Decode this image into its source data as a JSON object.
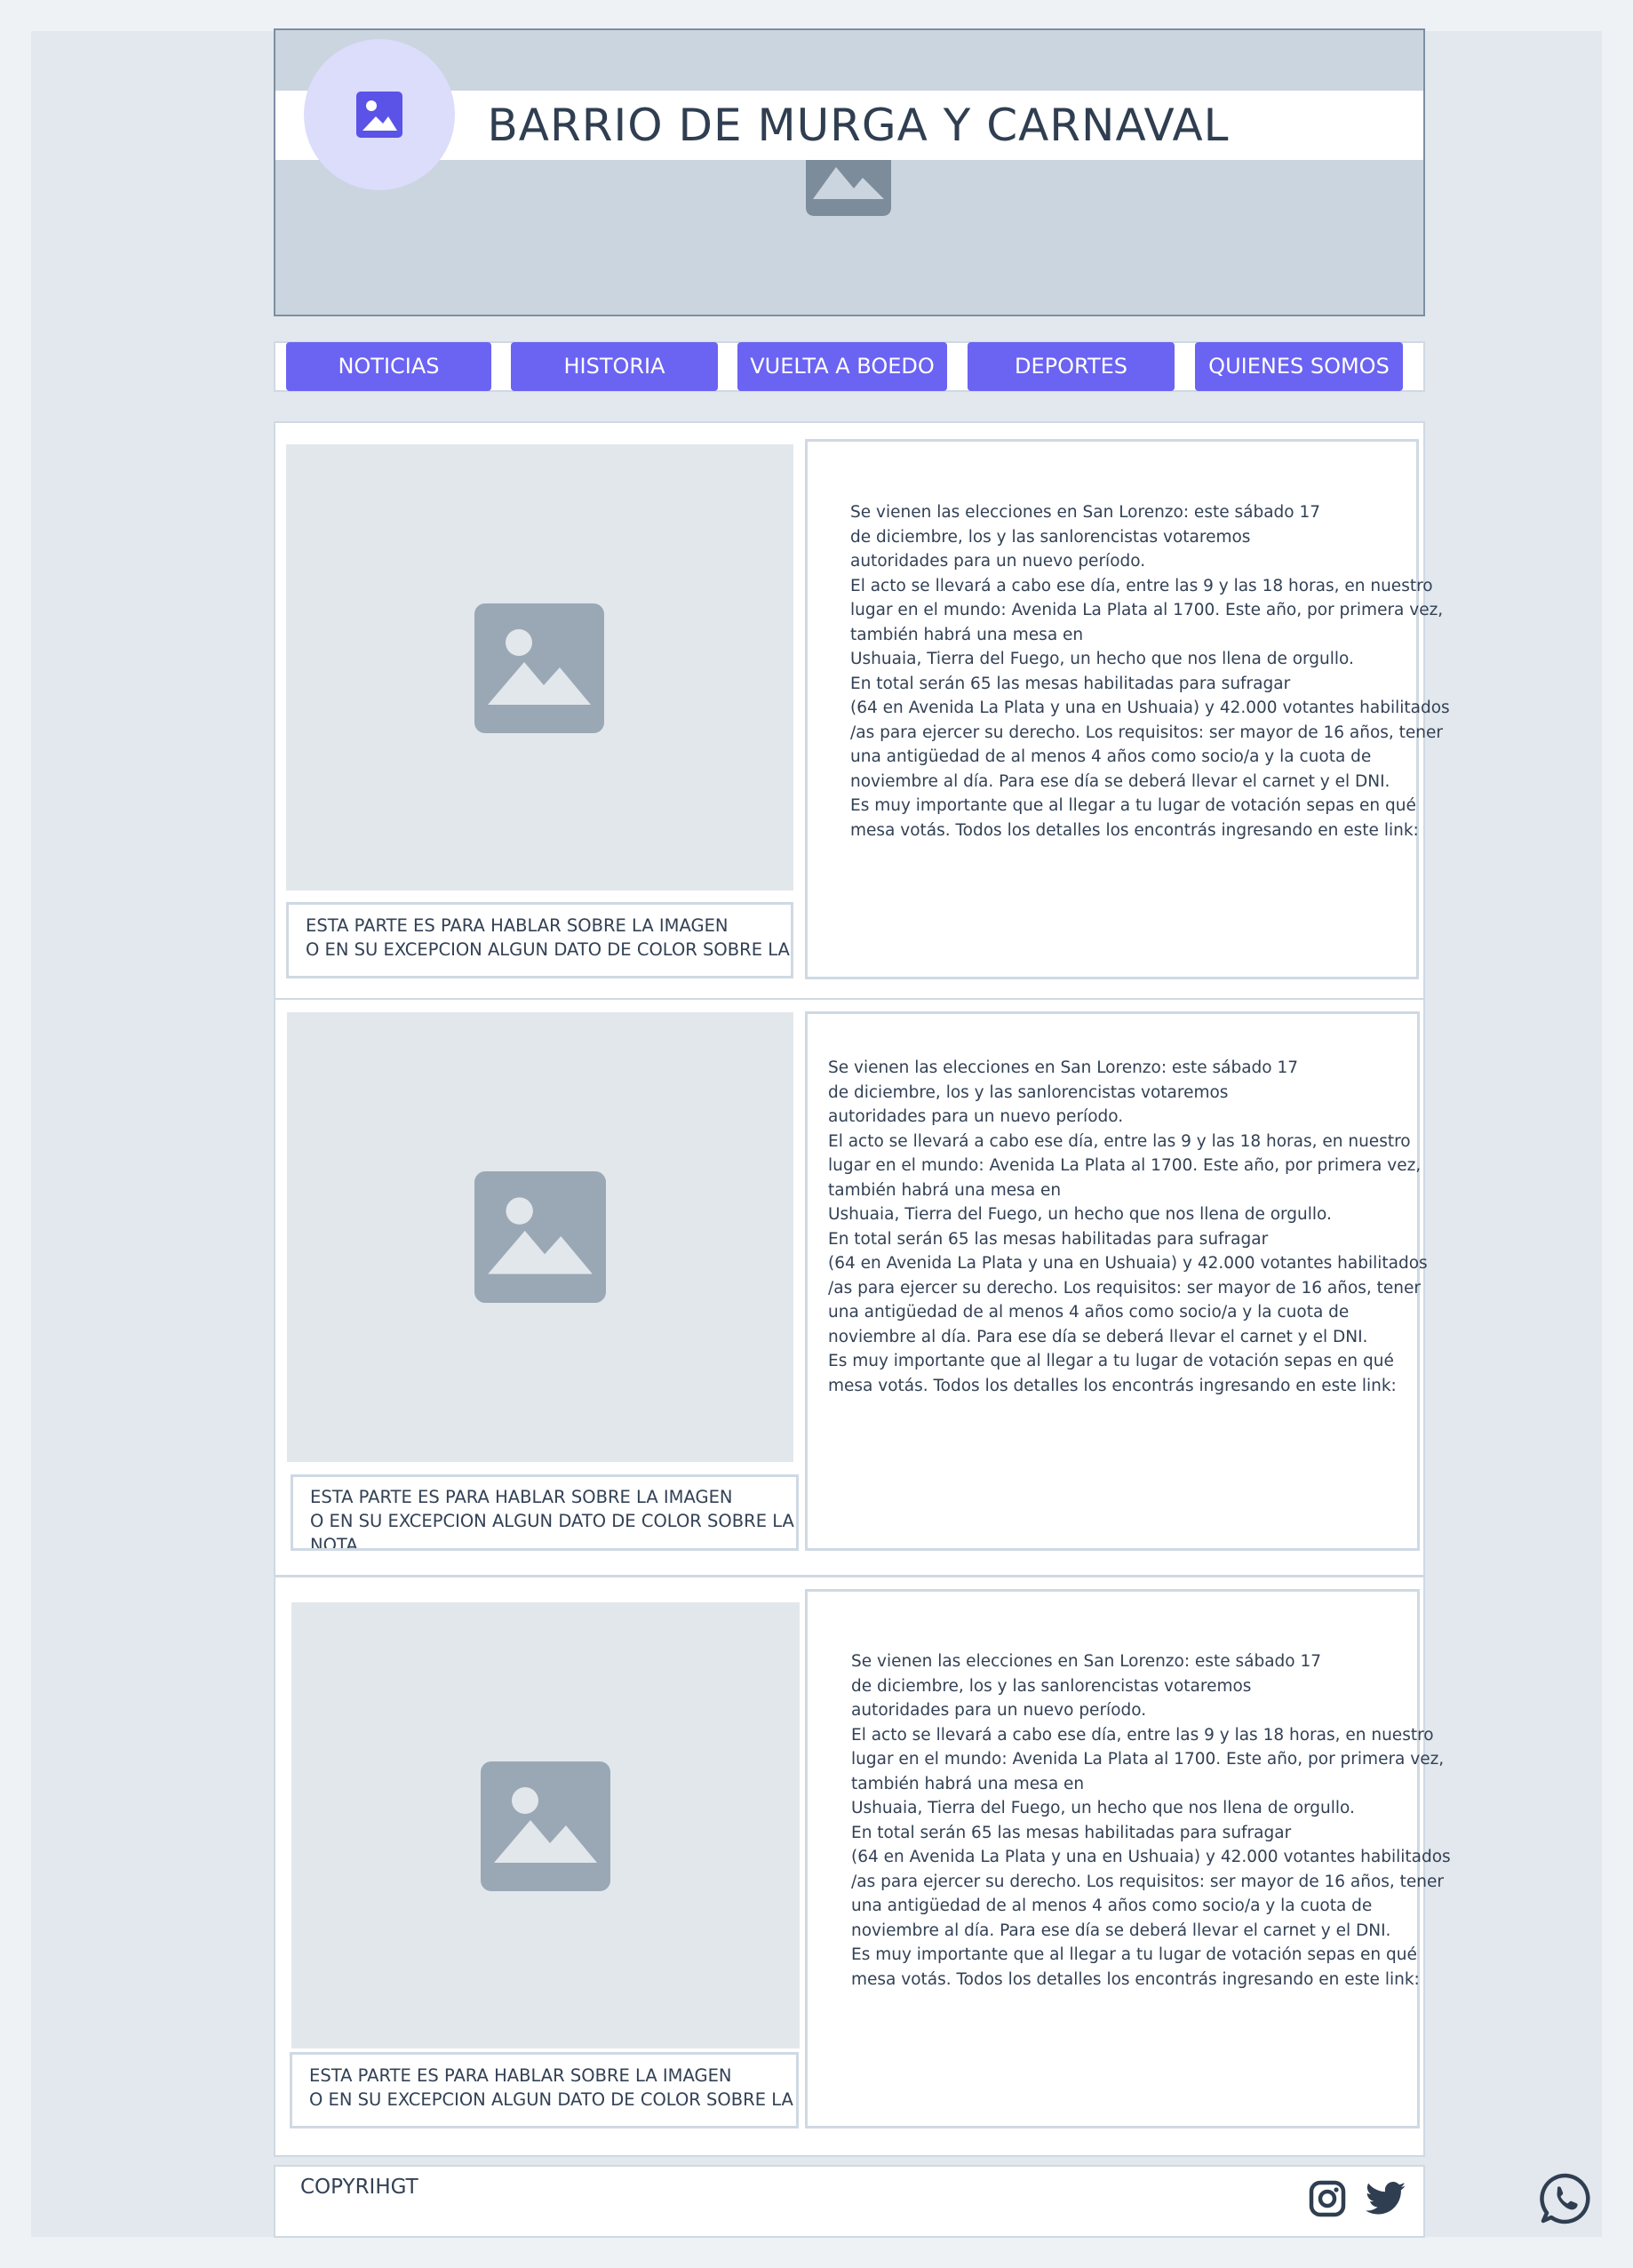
{
  "header": {
    "title": "BARRIO DE MURGA Y CARNAVAL",
    "logo_icon": "image-icon",
    "banner_icon": "image-icon"
  },
  "nav": {
    "items": [
      {
        "label": "NOTICIAS"
      },
      {
        "label": "HISTORIA"
      },
      {
        "label": "VUELTA A BOEDO"
      },
      {
        "label": "DEPORTES"
      },
      {
        "label": "QUIENES SOMOS"
      }
    ]
  },
  "articles": [
    {
      "caption": [
        "ESTA PARTE ES PARA HABLAR SOBRE LA IMAGEN",
        "O EN SU EXCEPCION ALGUN DATO DE COLOR SOBRE LA NOTA"
      ],
      "lines": [
        "Se vienen las elecciones en San Lorenzo: este sábado 17",
        "de diciembre, los y las sanlorencistas votaremos",
        "autoridades para un nuevo período.",
        "El acto se llevará a cabo ese día, entre las 9 y las 18 horas, en nuestro",
        "lugar en el mundo: Avenida La Plata al 1700. Este año, por primera vez,",
        "también habrá una mesa en",
        "Ushuaia, Tierra del Fuego, un hecho que nos llena de orgullo.",
        "En total serán 65 las mesas habilitadas para sufragar",
        "(64 en Avenida La Plata y una en Ushuaia) y 42.000 votantes habilitados",
        "/as para ejercer su derecho. Los requisitos: ser mayor de 16 años, tener",
        " una antigüedad de al menos 4 años como socio/a y la cuota de",
        "noviembre al día. Para ese día se deberá llevar el carnet y el DNI.",
        "Es muy importante que al llegar a tu lugar de votación sepas en qué",
        " mesa votás. Todos los detalles los encontrás ingresando en este link:"
      ]
    },
    {
      "caption": [
        "ESTA PARTE ES PARA HABLAR SOBRE LA IMAGEN",
        "O EN SU EXCEPCION ALGUN DATO DE COLOR SOBRE LA",
        "NOTA"
      ],
      "lines": [
        "Se vienen las elecciones en San Lorenzo: este sábado 17",
        "de diciembre, los y las sanlorencistas votaremos",
        "autoridades para un nuevo período.",
        "El acto se llevará a cabo ese día, entre las 9 y las 18 horas, en nuestro",
        "lugar en el mundo: Avenida La Plata al 1700. Este año, por primera vez,",
        "también habrá una mesa en",
        "Ushuaia, Tierra del Fuego, un hecho que nos llena de orgullo.",
        "En total serán 65 las mesas habilitadas para sufragar",
        "(64 en Avenida La Plata y una en Ushuaia) y 42.000 votantes habilitados",
        "/as para ejercer su derecho. Los requisitos: ser mayor de 16 años, tener",
        " una antigüedad de al menos 4 años como socio/a y la cuota de",
        "noviembre al día. Para ese día se deberá llevar el carnet y el DNI.",
        "Es muy importante que al llegar a tu lugar de votación sepas en qué",
        " mesa votás. Todos los detalles los encontrás ingresando en este link:"
      ]
    },
    {
      "caption": [
        "ESTA PARTE ES PARA HABLAR SOBRE LA IMAGEN",
        "O EN SU EXCEPCION ALGUN DATO DE COLOR SOBRE LA NOTA"
      ],
      "lines": [
        "Se vienen las elecciones en San Lorenzo: este sábado 17",
        "de diciembre, los y las sanlorencistas votaremos",
        "autoridades para un nuevo período.",
        "El acto se llevará a cabo ese día, entre las 9 y las 18 horas, en nuestro",
        "lugar en el mundo: Avenida La Plata al 1700. Este año, por primera vez,",
        "también habrá una mesa en",
        "Ushuaia, Tierra del Fuego, un hecho que nos llena de orgullo.",
        "En total serán 65 las mesas habilitadas para sufragar",
        "(64 en Avenida La Plata y una en Ushuaia) y 42.000 votantes habilitados",
        "/as para ejercer su derecho. Los requisitos: ser mayor de 16 años, tener",
        " una antigüedad de al menos 4 años como socio/a y la cuota de",
        "noviembre al día. Para ese día se deberá llevar el carnet y el DNI.",
        "Es muy importante que al llegar a tu lugar de votación sepas en qué",
        " mesa votás. Todos los detalles los encontrás ingresando en este link:"
      ]
    }
  ],
  "footer": {
    "copyright": "COPYRIHGT",
    "social_icons": [
      "instagram-icon",
      "twitter-icon"
    ]
  },
  "floating": {
    "icon": "whatsapp-icon"
  },
  "colors": {
    "accent": "#6b63f2",
    "header_bg": "#cbd5df",
    "placeholder": "#9aa8b5",
    "page_bg": "#e2e8ed"
  }
}
